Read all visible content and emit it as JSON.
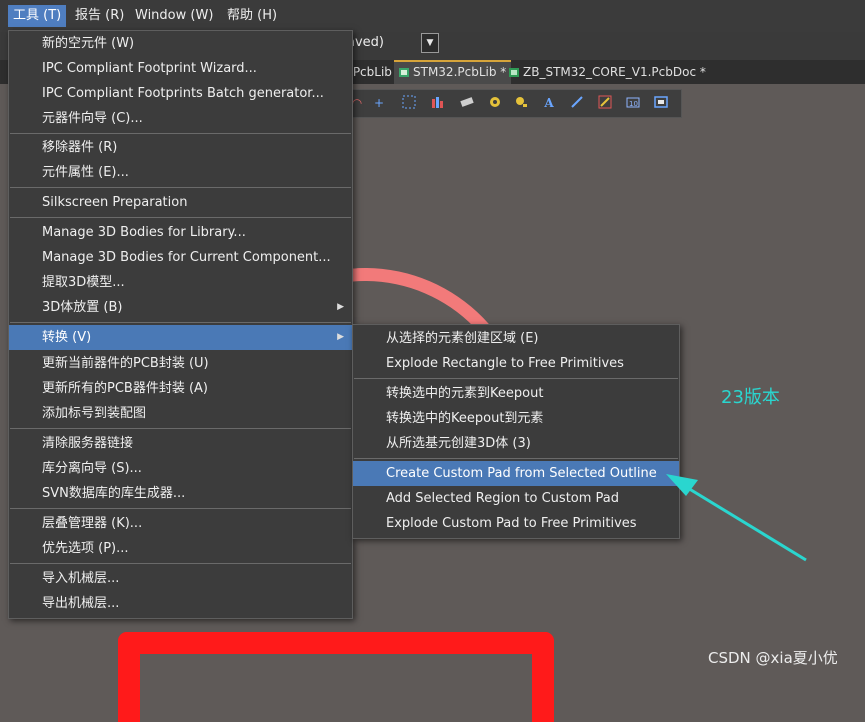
{
  "menubar": {
    "tools": "工具 (T)",
    "reports": "报告 (R)",
    "window": "Window (W)",
    "help": "帮助 (H)"
  },
  "toolbar": {
    "saved_text": "aved)",
    "dropdown_glyph": "▼"
  },
  "tabs": [
    {
      "label": ".PcbLib"
    },
    {
      "label": "STM32.PcbLib *"
    },
    {
      "label": "ZB_STM32_CORE_V1.PcbDoc *"
    }
  ],
  "tools_menu": [
    {
      "label": "新的空元件 (W)"
    },
    {
      "label": "IPC Compliant Footprint Wizard..."
    },
    {
      "label": "IPC Compliant Footprints Batch generator..."
    },
    {
      "label": "元器件向导 (C)..."
    },
    {
      "label": "移除器件 (R)"
    },
    {
      "label": "元件属性 (E)..."
    },
    {
      "label": "Silkscreen Preparation"
    },
    {
      "label": "Manage 3D Bodies for Library..."
    },
    {
      "label": "Manage 3D Bodies for Current Component..."
    },
    {
      "label": "提取3D模型..."
    },
    {
      "label": "3D体放置 (B)"
    },
    {
      "label": "转换 (V)"
    },
    {
      "label": "更新当前器件的PCB封装 (U)"
    },
    {
      "label": "更新所有的PCB器件封装 (A)"
    },
    {
      "label": "添加标号到装配图"
    },
    {
      "label": "清除服务器链接"
    },
    {
      "label": "库分离向导 (S)..."
    },
    {
      "label": "SVN数据库的库生成器..."
    },
    {
      "label": "层叠管理器 (K)..."
    },
    {
      "label": "优先选项 (P)..."
    },
    {
      "label": "导入机械层..."
    },
    {
      "label": "导出机械层..."
    }
  ],
  "convert_submenu": [
    {
      "label": "从选择的元素创建区域 (E)"
    },
    {
      "label": "Explode Rectangle to Free Primitives"
    },
    {
      "label": "转换选中的元素到Keepout"
    },
    {
      "label": "转换选中的Keepout到元素"
    },
    {
      "label": "从所选基元创建3D体 (3)"
    },
    {
      "label": "Create Custom Pad from Selected Outline"
    },
    {
      "label": "Add Selected Region to Custom Pad"
    },
    {
      "label": "Explode Custom Pad to Free Primitives"
    }
  ],
  "annotation": "23版本",
  "watermark": "CSDN @xia夏小优",
  "colors": {
    "highlight": "#4a79b6",
    "accent_cyan": "#2ad6cf",
    "outline_red": "#ff1a1a",
    "arc_pink": "#f27a7a"
  }
}
